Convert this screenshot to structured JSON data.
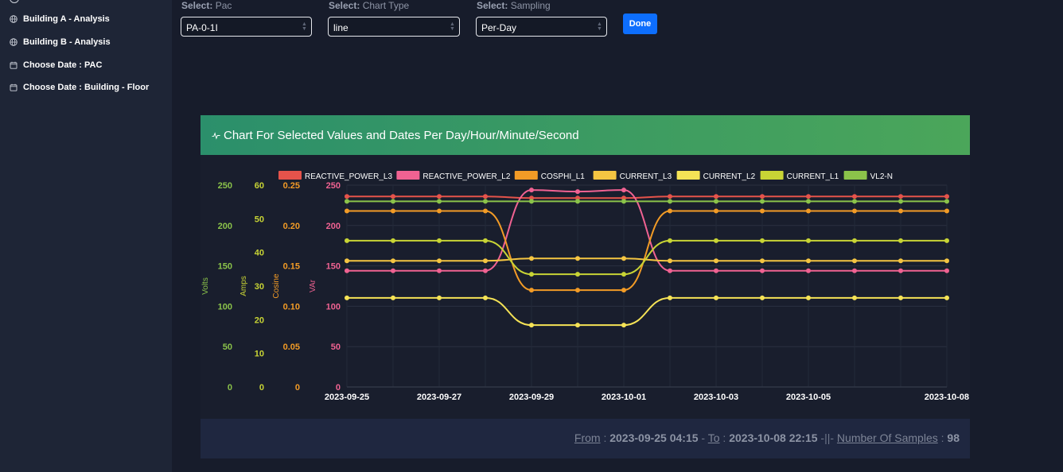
{
  "sidebar": {
    "items": [
      {
        "label": "Building A - Analysis",
        "icon": "globe-icon"
      },
      {
        "label": "Building B - Analysis",
        "icon": "globe-icon"
      },
      {
        "label": "Choose Date : PAC",
        "icon": "calendar-icon"
      },
      {
        "label": "Choose Date : Building - Floor",
        "icon": "calendar-icon"
      }
    ]
  },
  "controls": {
    "select_word": "Select:",
    "pac": {
      "label": "Pac",
      "value": "PA-0-1I"
    },
    "chart_type": {
      "label": "Chart Type",
      "value": "line"
    },
    "sampling": {
      "label": "Sampling",
      "value": "Per-Day"
    },
    "done_label": "Done"
  },
  "card": {
    "title": "Chart For Selected Values and Dates Per Day/Hour/Minute/Second"
  },
  "footer": {
    "from_label": "From",
    "from_value": "2023-09-25 04:15",
    "to_label": "To",
    "to_value": "2023-10-08 22:15",
    "separator": "-||-",
    "samples_label": "Number Of Samples",
    "samples_value": "98"
  },
  "colors": {
    "accent_button": "#0d6efd",
    "header_gradient_start": "#2b8f6b",
    "header_gradient_end": "#4ba65a"
  },
  "chart_data": {
    "type": "line",
    "x": [
      "2023-09-25",
      "2023-09-26",
      "2023-09-27",
      "2023-09-28",
      "2023-09-29",
      "2023-09-30",
      "2023-10-01",
      "2023-10-02",
      "2023-10-03",
      "2023-10-04",
      "2023-10-05",
      "2023-10-06",
      "2023-10-07",
      "2023-10-08"
    ],
    "x_tick_labels": [
      "2023-09-25",
      "2023-09-27",
      "2023-09-29",
      "2023-10-01",
      "2023-10-03",
      "2023-10-05",
      "2023-10-08"
    ],
    "series": [
      {
        "name": "REACTIVE_POWER_L3",
        "color": "#e5534b",
        "axis": "VAr",
        "values": [
          236,
          236,
          236,
          236,
          234,
          234,
          234,
          236,
          236,
          236,
          236,
          236,
          236,
          236
        ]
      },
      {
        "name": "REACTIVE_POWER_L2",
        "color": "#f06292",
        "axis": "VAr",
        "values": [
          144,
          144,
          144,
          144,
          244,
          242,
          244,
          144,
          144,
          144,
          144,
          144,
          144,
          144
        ]
      },
      {
        "name": "COSPHI_L1",
        "color": "#f29b26",
        "axis": "Cosine",
        "values": [
          0.218,
          0.218,
          0.218,
          0.218,
          0.12,
          0.12,
          0.12,
          0.218,
          0.218,
          0.218,
          0.218,
          0.218,
          0.218,
          0.218
        ]
      },
      {
        "name": "CURRENT_L3",
        "color": "#f4c542",
        "axis": "Amps",
        "values": [
          37.5,
          37.5,
          37.5,
          37.5,
          38.2,
          38.2,
          38.2,
          37.5,
          37.5,
          37.5,
          37.5,
          37.5,
          37.5,
          37.5
        ]
      },
      {
        "name": "CURRENT_L2",
        "color": "#f5e356",
        "axis": "Amps",
        "values": [
          26.5,
          26.5,
          26.5,
          26.5,
          18.4,
          18.4,
          18.4,
          26.5,
          26.5,
          26.5,
          26.5,
          26.5,
          26.5,
          26.5
        ]
      },
      {
        "name": "CURRENT_L1",
        "color": "#c8d435",
        "axis": "Amps",
        "values": [
          43.5,
          43.5,
          43.5,
          43.5,
          33.5,
          33.5,
          33.5,
          43.5,
          43.5,
          43.5,
          43.5,
          43.5,
          43.5,
          43.5
        ]
      },
      {
        "name": "VL2-N",
        "color": "#8bc34a",
        "axis": "Volts",
        "values": [
          230,
          230,
          230,
          230,
          230,
          230,
          230,
          230,
          230,
          230,
          230,
          230,
          230,
          230
        ]
      }
    ],
    "axes": [
      {
        "label": "Volts",
        "color": "#8bc34a",
        "ylim": [
          0,
          250
        ],
        "ticks": [
          "0",
          "50",
          "100",
          "150",
          "200",
          "250"
        ]
      },
      {
        "label": "Amps",
        "color": "#c8d435",
        "ylim": [
          0,
          60
        ],
        "ticks": [
          "0",
          "10",
          "20",
          "30",
          "40",
          "50",
          "60"
        ]
      },
      {
        "label": "Cosine",
        "color": "#f29b26",
        "ylim": [
          0,
          0.25
        ],
        "ticks": [
          "0",
          "0.05",
          "0.10",
          "0.15",
          "0.20",
          "0.25"
        ]
      },
      {
        "label": "VAr",
        "color": "#f06292",
        "ylim": [
          0,
          250
        ],
        "ticks": [
          "0",
          "50",
          "100",
          "150",
          "200",
          "250"
        ]
      }
    ],
    "grid": true,
    "legend_position": "top"
  }
}
